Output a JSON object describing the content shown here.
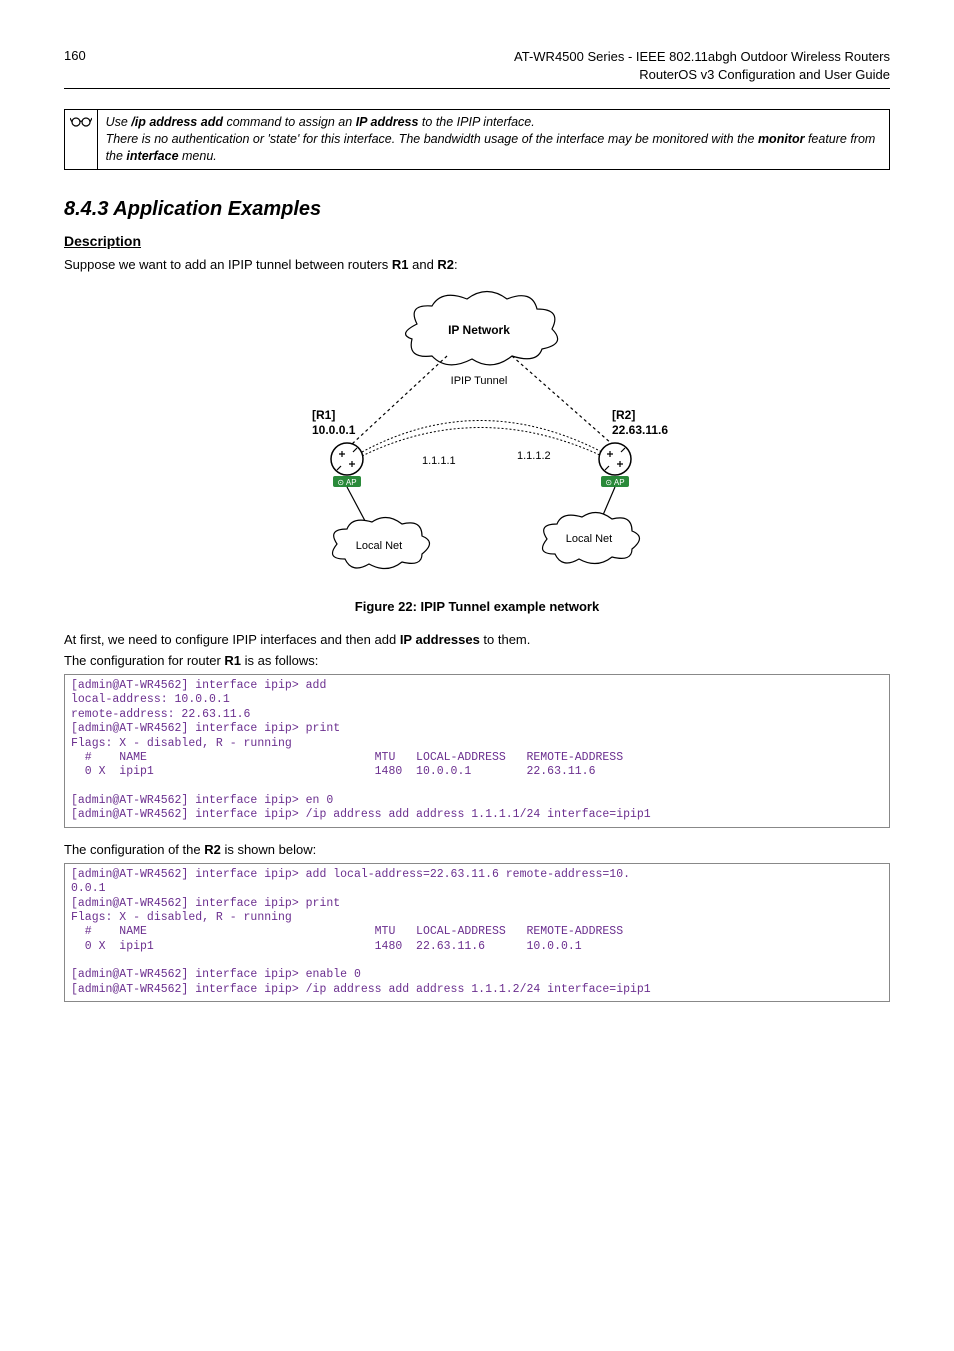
{
  "header": {
    "page_number": "160",
    "title_line1": "AT-WR4500 Series - IEEE 802.11abgh Outdoor Wireless Routers",
    "title_line2": "RouterOS v3 Configuration and User Guide"
  },
  "note": {
    "line1_pre": "Use ",
    "line1_cmd": "/ip address add",
    "line1_mid": " command to assign an ",
    "line1_ip": "IP address",
    "line1_post": " to the IPIP interface.",
    "line2_pre": "There is no authentication or 'state' for this interface. The bandwidth usage of the interface may be monitored with the ",
    "monitor": "monitor",
    "line2_mid": " feature from the ",
    "interface": "interface",
    "line2_post": " menu."
  },
  "section": {
    "heading": "8.4.3 Application Examples",
    "desc_heading": "Description",
    "intro_pre": "Suppose we want to add an IPIP tunnel between routers ",
    "r1": "R1",
    "intro_and": " and ",
    "r2": "R2",
    "intro_post": ":"
  },
  "diagram": {
    "ip_network": "IP Network",
    "ipip_tunnel": "IPIP Tunnel",
    "r1_label": "[R1]",
    "r1_ip": "10.0.0.1",
    "r2_label": "[R2]",
    "r2_ip": "22.63.11.6",
    "left_inner": "1.1.1.1",
    "right_inner": "1.1.1.2",
    "local_net": "Local Net"
  },
  "figure_caption": "Figure 22: IPIP Tunnel example network",
  "after_fig": {
    "line1_pre": "At first, we need to configure IPIP interfaces and then add ",
    "ipaddr": "IP addresses",
    "line1_post": " to them.",
    "line2_pre": "The configuration for router ",
    "r1b": "R1",
    "line2_post": " is as follows:"
  },
  "code1": "[admin@AT-WR4562] interface ipip> add\nlocal-address: 10.0.0.1\nremote-address: 22.63.11.6\n[admin@AT-WR4562] interface ipip> print\nFlags: X - disabled, R - running\n  #    NAME                                 MTU   LOCAL-ADDRESS   REMOTE-ADDRESS\n  0 X  ipip1                                1480  10.0.0.1        22.63.11.6\n\n[admin@AT-WR4562] interface ipip> en 0\n[admin@AT-WR4562] interface ipip> /ip address add address 1.1.1.1/24 interface=ipip1",
  "mid_text": {
    "pre": "The configuration of the ",
    "r2b": "R2",
    "post": " is shown below:"
  },
  "code2": "[admin@AT-WR4562] interface ipip> add local-address=22.63.11.6 remote-address=10.\n0.0.1\n[admin@AT-WR4562] interface ipip> print\nFlags: X - disabled, R - running\n  #    NAME                                 MTU   LOCAL-ADDRESS   REMOTE-ADDRESS\n  0 X  ipip1                                1480  22.63.11.6      10.0.0.1\n\n[admin@AT-WR4562] interface ipip> enable 0\n[admin@AT-WR4562] interface ipip> /ip address add address 1.1.1.2/24 interface=ipip1"
}
